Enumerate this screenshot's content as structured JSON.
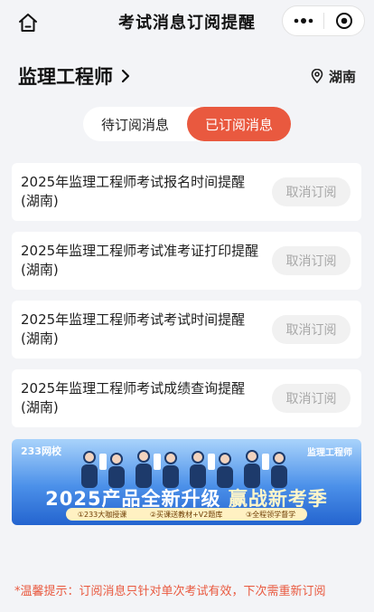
{
  "topbar": {
    "title": "考试消息订阅提醒",
    "home_icon": "home-icon",
    "more_icon": "more-dots-icon",
    "close_icon": "mini-program-close-icon"
  },
  "header": {
    "exam": "监理工程师",
    "region": "湖南"
  },
  "tabs": [
    {
      "label": "待订阅消息",
      "active": false
    },
    {
      "label": "已订阅消息",
      "active": true
    }
  ],
  "subscriptions": [
    {
      "title": "2025年监理工程师考试报名时间提醒(湖南)",
      "action": "取消订阅"
    },
    {
      "title": "2025年监理工程师考试准考证打印提醒(湖南)",
      "action": "取消订阅"
    },
    {
      "title": "2025年监理工程师考试考试时间提醒(湖南)",
      "action": "取消订阅"
    },
    {
      "title": "2025年监理工程师考试成绩查询提醒(湖南)",
      "action": "取消订阅"
    }
  ],
  "banner": {
    "logo": "233网校",
    "subtitle": "监理工程师",
    "headline_1": "2025产品全新升级",
    "headline_2": "赢战新考季",
    "features": [
      "①233大咖授课",
      "②买课送教材+V2题库",
      "③全程领学督学"
    ]
  },
  "tip": "*温馨提示：订阅消息只针对单次考试有效，下次需重新订阅",
  "colors": {
    "accent": "#e9593f",
    "background": "#f3f4f7"
  }
}
